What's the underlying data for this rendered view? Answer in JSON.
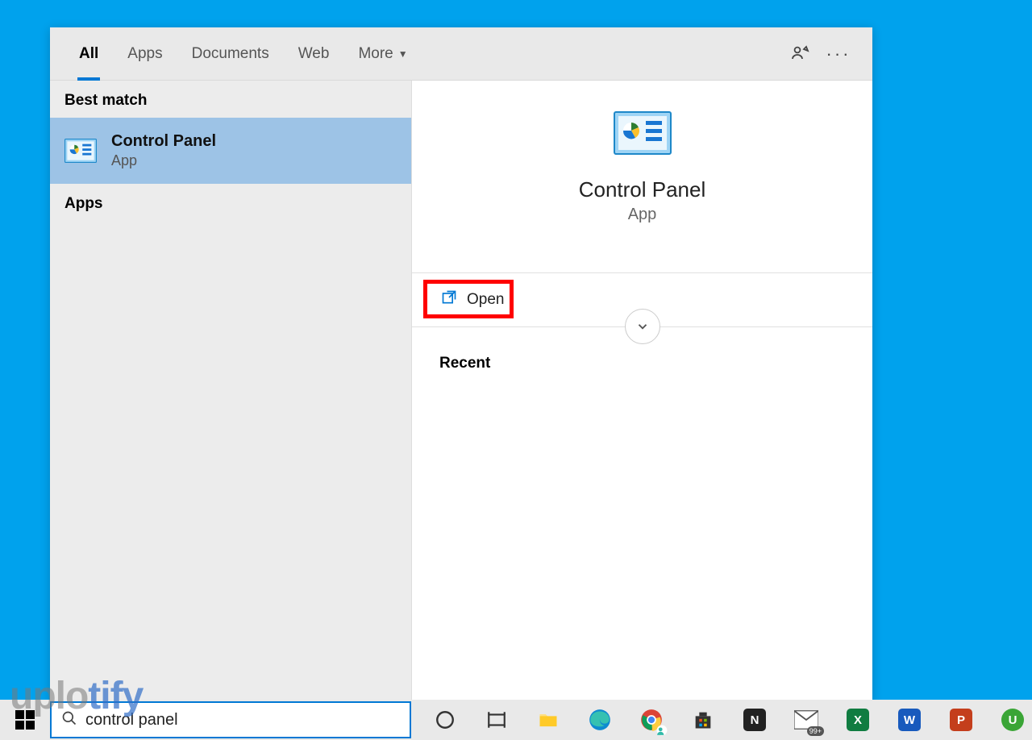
{
  "tabs": {
    "all": "All",
    "apps": "Apps",
    "documents": "Documents",
    "web": "Web",
    "more": "More"
  },
  "sections": {
    "best_match": "Best match",
    "apps": "Apps"
  },
  "result": {
    "title": "Control Panel",
    "subtitle": "App"
  },
  "preview": {
    "title": "Control Panel",
    "subtitle": "App",
    "open_label": "Open",
    "recent_label": "Recent"
  },
  "search": {
    "value": "control panel"
  },
  "watermark": {
    "pre": "uplo",
    "accent": "tify"
  }
}
